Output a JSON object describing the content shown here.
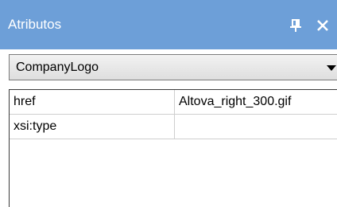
{
  "panel": {
    "title": "Atributos",
    "pin_icon": "pin-icon",
    "close_icon": "close-icon",
    "titlebar_color": "#6d9fd8"
  },
  "selector": {
    "value": "CompanyLogo",
    "arrow_icon": "chevron-down-icon"
  },
  "attributes": {
    "rows": [
      {
        "name": "href",
        "value": "Altova_right_300.gif"
      },
      {
        "name": "xsi:type",
        "value": ""
      }
    ]
  }
}
